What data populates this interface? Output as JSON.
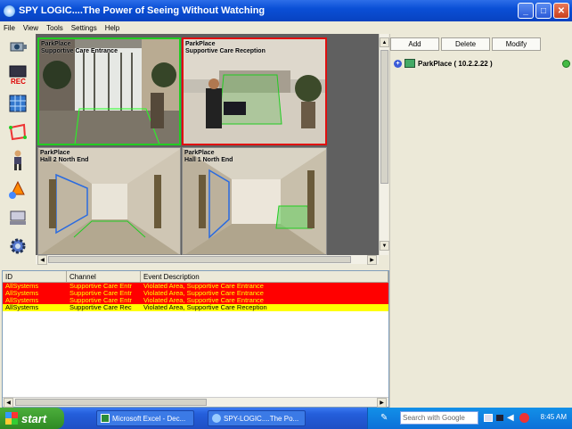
{
  "window": {
    "title": "SPY LOGIC....The Power of Seeing Without Watching"
  },
  "menu": [
    "File",
    "View",
    "Tools",
    "Settings",
    "Help"
  ],
  "toolbar": [
    {
      "name": "camera-settings-icon",
      "glyph": "📷"
    },
    {
      "name": "record-icon",
      "glyph": "REC"
    },
    {
      "name": "grid-view-icon",
      "glyph": "▦"
    },
    {
      "name": "region-draw-icon",
      "glyph": "⬚"
    },
    {
      "name": "person-icon",
      "glyph": "🚶"
    },
    {
      "name": "alarm-icon",
      "glyph": "🔔"
    },
    {
      "name": "network-icon",
      "glyph": "🖧"
    },
    {
      "name": "gear-icon",
      "glyph": "⚙"
    }
  ],
  "cameras": [
    {
      "line1": "ParkPlace",
      "line2": "Supportive Care Entrance",
      "border": "#22cc22"
    },
    {
      "line1": "ParkPlace",
      "line2": "Supportive Care Reception",
      "border": "#e01010"
    },
    {
      "line1": "ParkPlace",
      "line2": "Hall 2 North End",
      "border": "#8a8a8a"
    },
    {
      "line1": "ParkPlace",
      "line2": "Hall 1 North End",
      "border": "#8a8a8a"
    }
  ],
  "right": {
    "buttons": {
      "add": "Add",
      "delete": "Delete",
      "modify": "Modify"
    },
    "tree_item": "ParkPlace ( 10.2.2.22 )"
  },
  "events": {
    "headers": {
      "id": "ID",
      "channel": "Channel",
      "desc": "Event Description"
    },
    "rows": [
      {
        "id": "AllSystems",
        "channel": "Supportive Care Entr",
        "desc": "Violated Area, Supportive Care Entrance",
        "bg": "#ff0000",
        "fg": "#ffff00"
      },
      {
        "id": "AllSystems",
        "channel": "Supportive Care Entr",
        "desc": "Violated Area, Supportive Care Entrance",
        "bg": "#ff0000",
        "fg": "#ffff00"
      },
      {
        "id": "AllSystems",
        "channel": "Supportive Care Entr",
        "desc": "Violated Area, Supportive Care Entrance",
        "bg": "#ff0000",
        "fg": "#ffff00"
      },
      {
        "id": "AllSystems",
        "channel": "Supportive Care Rec",
        "desc": "Violated Area, Supportive Care Reception",
        "bg": "#ffff00",
        "fg": "#000000"
      }
    ]
  },
  "taskbar": {
    "start": "start",
    "tasks": [
      {
        "label": "Microsoft Excel - Dec..."
      },
      {
        "label": "SPY-LOGIC....The Po..."
      }
    ],
    "search_placeholder": "Search with Google",
    "clock": "8:45 AM"
  }
}
